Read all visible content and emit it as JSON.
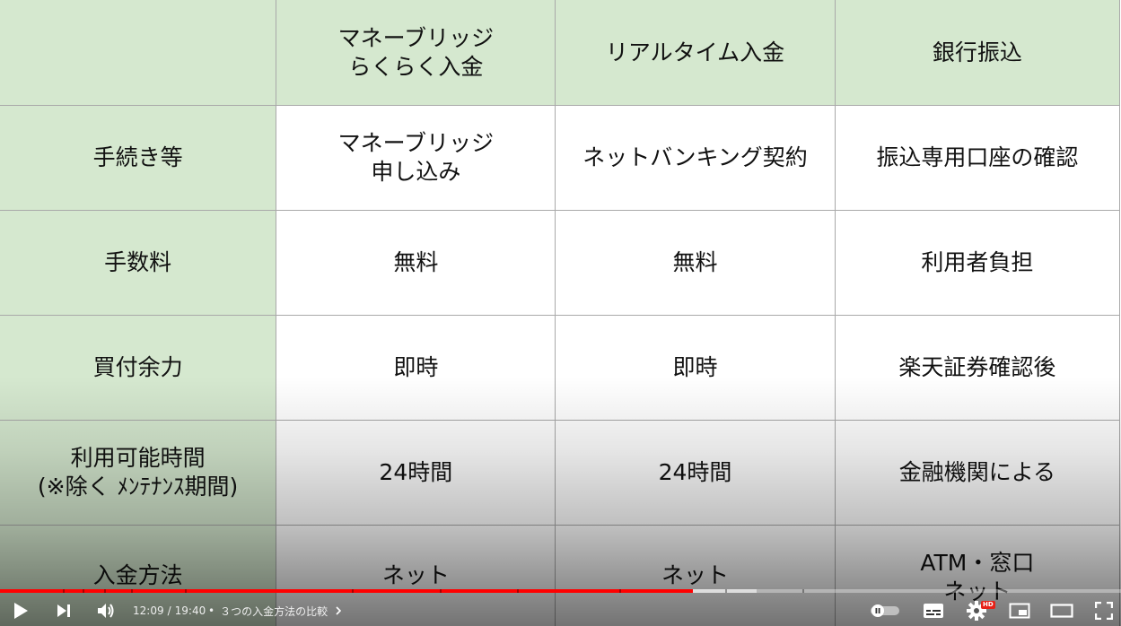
{
  "table": {
    "headers": [
      "",
      "マネーブリッジ\nらくらく入金",
      "リアルタイム入金",
      "銀行振込"
    ],
    "rows": [
      {
        "label": "手続き等",
        "cells": [
          "マネーブリッジ\n申し込み",
          "ネットバンキング契約",
          "振込専用口座の確認"
        ]
      },
      {
        "label": "手数料",
        "cells": [
          "無料",
          "無料",
          "利用者負担"
        ]
      },
      {
        "label": "買付余力",
        "cells": [
          "即時",
          "即時",
          "楽天証券確認後"
        ]
      },
      {
        "label": "利用可能時間\n(※除く ﾒﾝﾃﾅﾝｽ期間)",
        "cells": [
          "24時間",
          "24時間",
          "金融機関による"
        ]
      },
      {
        "label": "入金方法",
        "cells": [
          "ネット",
          "ネット",
          "ATM・窓口\nネット"
        ]
      }
    ],
    "colors": {
      "header_bg": "#d5e8cf",
      "label_bg": "#d5e8cf",
      "value_bg": "#ffffff",
      "border": "#a9a9a9"
    }
  },
  "player": {
    "current_time": "12:09",
    "duration": "19:40",
    "chapter_title": "３つの入金方法の比較",
    "progress": 0.618,
    "buffered": 0.675,
    "progress_color": "#ff0000",
    "hd_badge": "HD",
    "icons": [
      "play-icon",
      "next-icon",
      "volume-icon",
      "autoplay-toggle-icon",
      "subtitles-icon",
      "settings-icon",
      "miniplayer-icon",
      "theater-icon",
      "fullscreen-icon"
    ]
  }
}
